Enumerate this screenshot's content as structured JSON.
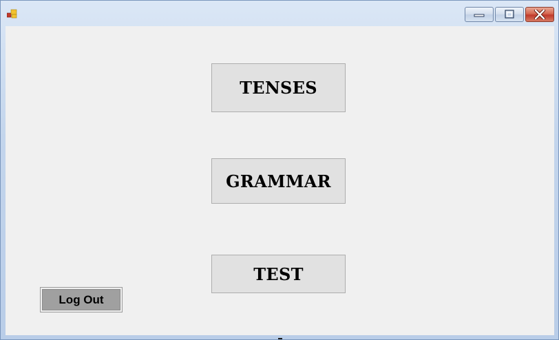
{
  "window": {
    "icon": "app-icon",
    "controls": {
      "minimize_icon": "minimize-icon",
      "maximize_icon": "maximize-icon",
      "close_icon": "close-icon"
    }
  },
  "menu_buttons": {
    "tenses_label": "TENSES",
    "grammar_label": "GRAMMAR",
    "test_label": "TEST"
  },
  "logout": {
    "label": "Log Out"
  },
  "colors": {
    "client_background": "#f0f0f0",
    "button_face": "#e1e1e1",
    "logout_face": "#a0a0a0",
    "close_button": "#c0392b"
  }
}
